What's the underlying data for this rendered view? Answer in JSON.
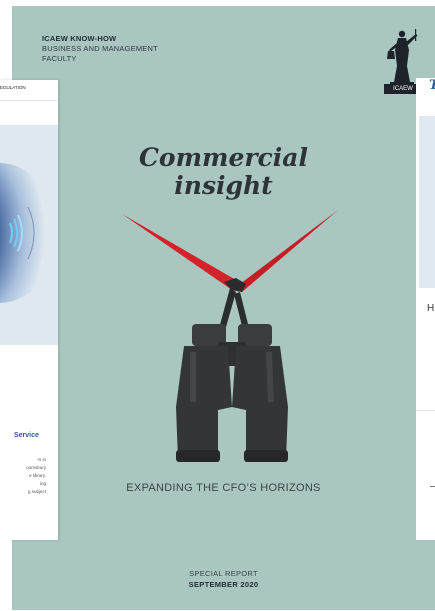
{
  "cover": {
    "header_line1": "ICAEW KNOW-HOW",
    "header_line2": "BUSINESS AND MANAGEMENT",
    "header_line3": "FACULTY",
    "logo_text": "ICAEW",
    "title_line1": "Commercial",
    "title_line2": "insight",
    "subtitle": "EXPANDING THE CFO’S HORIZONS",
    "footer_line1": "SPECIAL REPORT",
    "footer_line2": "SEPTEMBER 2020"
  },
  "left_card": {
    "top_text": "EGULATION",
    "service_heading": "Service",
    "body_lines": [
      "rs in",
      "oomsbury",
      "e library.",
      "ing",
      "g subject"
    ]
  },
  "right_card": {
    "title_letter": "T",
    "partial_letter": "H"
  },
  "colors": {
    "cover_bg": "#a9c7c0",
    "accent_red": "#d2232a",
    "service_blue": "#2a5e98"
  },
  "icons": [
    "binoculars-image",
    "icaew-statue-logo",
    "radio-wave-graphic"
  ]
}
